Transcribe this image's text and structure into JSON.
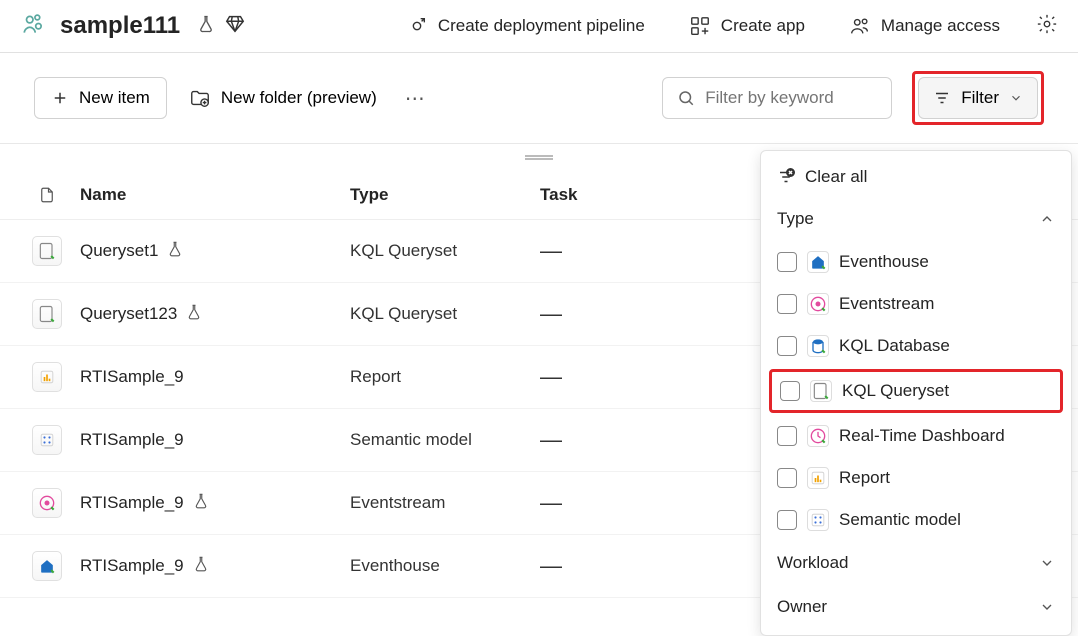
{
  "header": {
    "workspace_title": "sample111",
    "actions": {
      "create_pipeline": "Create deployment pipeline",
      "create_app": "Create app",
      "manage_access": "Manage access"
    }
  },
  "toolbar": {
    "new_item": "New item",
    "new_folder": "New folder (preview)",
    "filter_placeholder": "Filter by keyword",
    "filter_label": "Filter"
  },
  "columns": {
    "name": "Name",
    "type": "Type",
    "task": "Task"
  },
  "rows": [
    {
      "name": "Queryset1",
      "type": "KQL Queryset",
      "task": "—",
      "icon": "queryset",
      "badge": true
    },
    {
      "name": "Queryset123",
      "type": "KQL Queryset",
      "task": "—",
      "icon": "queryset",
      "badge": true
    },
    {
      "name": "RTISample_9",
      "type": "Report",
      "task": "—",
      "icon": "report",
      "badge": false
    },
    {
      "name": "RTISample_9",
      "type": "Semantic model",
      "task": "—",
      "icon": "semantic",
      "badge": false
    },
    {
      "name": "RTISample_9",
      "type": "Eventstream",
      "task": "—",
      "icon": "eventstream",
      "badge": true
    },
    {
      "name": "RTISample_9",
      "type": "Eventhouse",
      "task": "—",
      "icon": "eventhouse",
      "badge": true
    }
  ],
  "filter_panel": {
    "clear_all": "Clear all",
    "type_label": "Type",
    "types": [
      {
        "label": "Eventhouse",
        "icon": "eventhouse"
      },
      {
        "label": "Eventstream",
        "icon": "eventstream"
      },
      {
        "label": "KQL Database",
        "icon": "kqldb"
      },
      {
        "label": "KQL Queryset",
        "icon": "queryset",
        "highlight": true
      },
      {
        "label": "Real-Time Dashboard",
        "icon": "rtdash"
      },
      {
        "label": "Report",
        "icon": "report"
      },
      {
        "label": "Semantic model",
        "icon": "semantic"
      }
    ],
    "workload_label": "Workload",
    "owner_label": "Owner"
  }
}
